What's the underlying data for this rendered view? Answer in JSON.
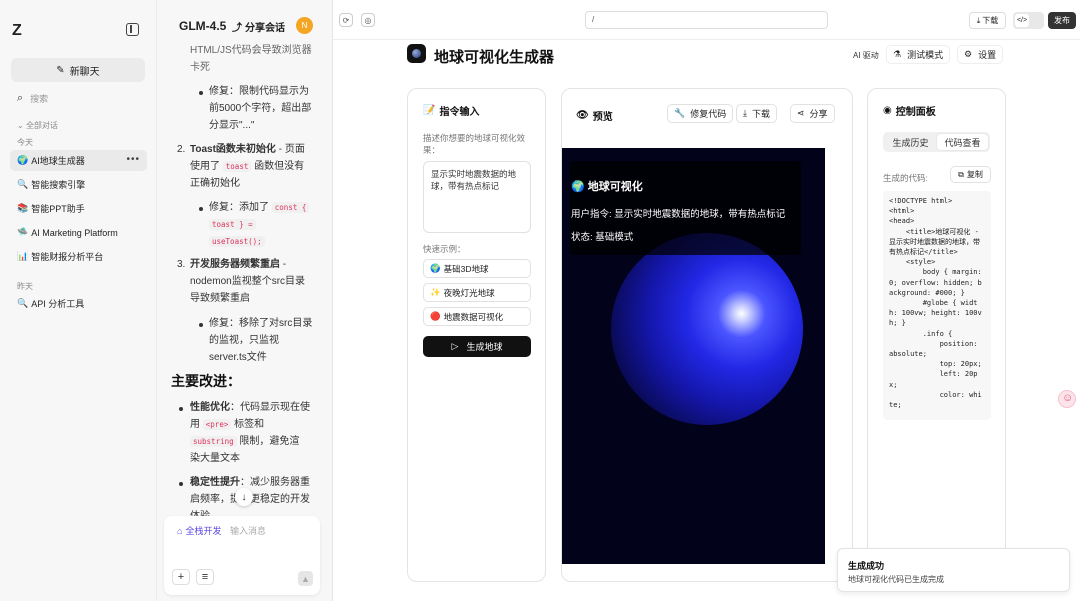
{
  "sidebar": {
    "logo": "Z",
    "new_chat": "新聊天",
    "search_placeholder": "搜索",
    "all_conversations": "全部对话",
    "today_label": "今天",
    "yesterday_label": "昨天",
    "today_items": [
      {
        "icon": "🌍",
        "label": "AI地球生成器"
      },
      {
        "icon": "🔍",
        "label": "智能搜索引擎"
      },
      {
        "icon": "📚",
        "label": "智能PPT助手"
      },
      {
        "icon": "🛸",
        "label": "AI Marketing Platform"
      },
      {
        "icon": "📊",
        "label": "智能财报分析平台"
      }
    ],
    "yesterday_items": [
      {
        "icon": "🔍",
        "label": "API 分析工具"
      }
    ],
    "more": "•••"
  },
  "chat": {
    "model": "GLM-4.5",
    "share": "分享会话",
    "avatar": "N",
    "l1": "HTML/JS代码会导致浏览器",
    "l2": "卡死",
    "fix1": [
      "修复：限制代码显示为",
      "前5000个字符，超出部",
      "分显示\"...\""
    ],
    "item2_num": "2.",
    "item2_bold": "Toast函数未初始化",
    "item2_rest": " - 页面",
    "item2_l2a": "使用了 ",
    "item2_code": "toast",
    "item2_l2b": " 函数但没有",
    "item2_l3": "正确初始化",
    "fix2_a": "修复：添加了 ",
    "fix2_code1": "const {",
    "fix2_code2": "toast } =",
    "fix2_code3": "useToast();",
    "item3_num": "3.",
    "item3_bold": "开发服务器频繁重启",
    "item3_rest": " -",
    "item3_l2": "nodemon监视整个src目录",
    "item3_l3": "导致频繁重启",
    "fix3": [
      "修复：移除了对src目录",
      "的监视，只监视",
      "server.ts文件"
    ],
    "heading": "主要改进：",
    "imp1_bold": "性能优化",
    "imp1_rest": "：代码显示现在使",
    "imp1_l2a": "用 ",
    "imp1_code1": "<pre>",
    "imp1_l2b": " 标签和",
    "imp1_code2": "substring",
    "imp1_l3b": " 限制，避免渲",
    "imp1_l4": "染大量文本",
    "imp2_bold": "稳定性提升",
    "imp2_rest": "：减少服务器重",
    "imp2_l2": "启频率，提供更稳定的开发",
    "imp2_l3": "体验",
    "input_mode": "全栈开发",
    "input_placeholder": "输入消息"
  },
  "topbar": {
    "url": "/",
    "download": "下载",
    "publish": "发布"
  },
  "app": {
    "title": "地球可视化生成器",
    "ai_driven": "AI 驱动",
    "test_mode": "测试模式",
    "settings": "设置"
  },
  "command": {
    "title": "指令输入",
    "desc": "描述你想要的地球可视化效果：",
    "text": "显示实时地震数据的地球，带有热点标记",
    "quick_label": "快速示例：",
    "examples": [
      {
        "icon": "🌍",
        "label": "基础3D地球"
      },
      {
        "icon": "✨",
        "label": "夜晚灯光地球"
      },
      {
        "icon": "🔴",
        "label": "地震数据可视化"
      }
    ],
    "generate": "生成地球"
  },
  "preview": {
    "title": "预览",
    "fix_code": "修复代码",
    "download": "下载",
    "share": "分享",
    "overlay_title": "🌍 地球可视化",
    "overlay_cmd": "用户指令: 显示实时地震数据的地球，带有热点标记",
    "overlay_status": "状态: 基础模式"
  },
  "control": {
    "title": "控制面板",
    "tab_history": "生成历史",
    "tab_code": "代码查看",
    "code_label": "生成的代码:",
    "copy": "复制",
    "code": "<!DOCTYPE html>\n<html>\n<head>\n    <title>地球可视化 - 显示实时地震数据的地球，带有热点标记</title>\n    <style>\n        body { margin: 0; overflow: hidden; background: #000; }\n        #globe { width: 100vw; height: 100vh; }\n        .info {\n            position: absolute;\n            top: 20px;\n            left: 20px;\n            color: white;"
  },
  "toast": {
    "title": "生成成功",
    "desc": "地球可视化代码已生成完成"
  }
}
